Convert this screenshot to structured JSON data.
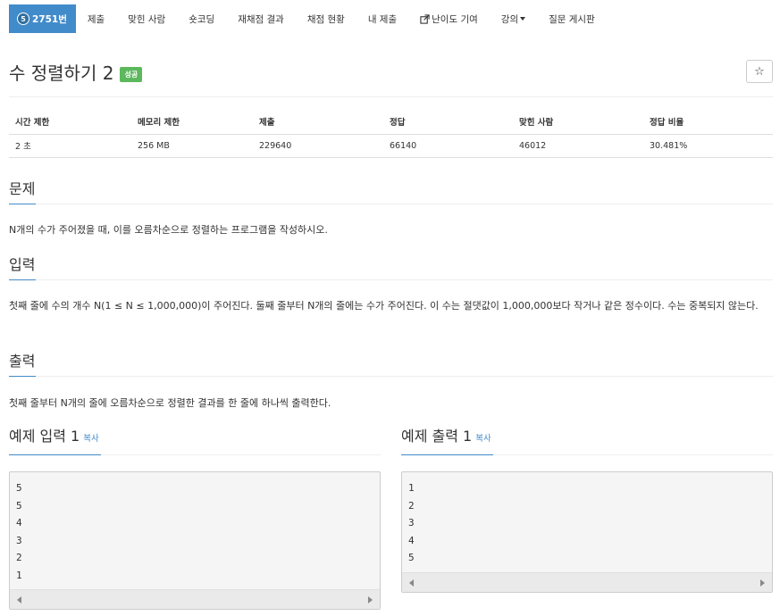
{
  "nav": {
    "problem_badge": "5",
    "problem_number": "2751번",
    "items": [
      "제출",
      "맞힌 사람",
      "숏코딩",
      "재채점 결과",
      "채점 현황",
      "내 제출",
      "난이도 기여",
      "강의",
      "질문 게시판"
    ]
  },
  "title": "수 정렬하기 2",
  "result_label": "성공",
  "star_icon": "☆",
  "table": {
    "headers": [
      "시간 제한",
      "메모리 제한",
      "제출",
      "정답",
      "맞힌 사람",
      "정답 비율"
    ],
    "row": [
      "2 초",
      "256 MB",
      "229640",
      "66140",
      "46012",
      "30.481%"
    ]
  },
  "sections": {
    "problem": {
      "heading": "문제",
      "text": "N개의 수가 주어졌을 때, 이를 오름차순으로 정렬하는 프로그램을 작성하시오."
    },
    "input": {
      "heading": "입력",
      "text": "첫째 줄에 수의 개수 N(1 ≤ N ≤ 1,000,000)이 주어진다. 둘째 줄부터 N개의 줄에는 수가 주어진다. 이 수는 절댓값이 1,000,000보다 작거나 같은 정수이다. 수는 중복되지 않는다."
    },
    "output": {
      "heading": "출력",
      "text": "첫째 줄부터 N개의 줄에 오름차순으로 정렬한 결과를 한 줄에 하나씩 출력한다."
    }
  },
  "sample_input": {
    "heading": "예제 입력 1",
    "copy_label": "복사",
    "lines": [
      "5",
      "5",
      "4",
      "3",
      "2",
      "1"
    ]
  },
  "sample_output": {
    "heading": "예제 출력 1",
    "copy_label": "복사",
    "lines": [
      "1",
      "2",
      "3",
      "4",
      "5"
    ]
  },
  "colors": {
    "nav_active": "#428bca",
    "success": "#5cb85c",
    "link": "#428bca"
  }
}
